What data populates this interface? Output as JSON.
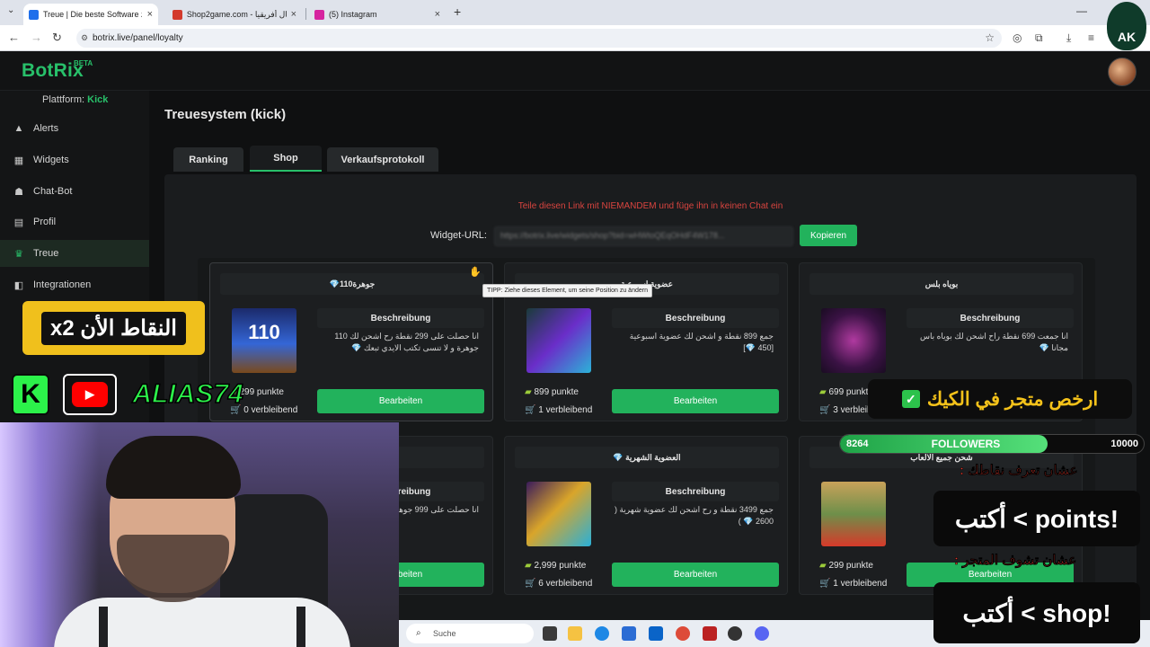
{
  "browser": {
    "tabs": [
      {
        "title": "Treue | Die beste Software zur C",
        "favicon_color": "#1f6feb"
      },
      {
        "title": "Shop2game.com - شمال أفريقيا",
        "favicon_color": "#d33a2c"
      },
      {
        "title": "(5) Instagram",
        "favicon_color": "#d6249f"
      }
    ],
    "url": "botrix.live/panel/loyalty"
  },
  "app": {
    "logo": "BotRix",
    "logo_badge": "BETA",
    "platform_label": "Plattform:",
    "platform_value": "Kick"
  },
  "sidebar": {
    "items": [
      {
        "label": "Alerts",
        "icon": "warning-icon"
      },
      {
        "label": "Widgets",
        "icon": "grid-icon"
      },
      {
        "label": "Chat-Bot",
        "icon": "robot-icon"
      },
      {
        "label": "Profil",
        "icon": "id-card-icon"
      },
      {
        "label": "Treue",
        "icon": "trophy-icon",
        "active": true
      },
      {
        "label": "Integrationen",
        "icon": "plug-icon"
      }
    ]
  },
  "main": {
    "title": "Treuesystem (kick)",
    "tabs": [
      {
        "label": "Ranking"
      },
      {
        "label": "Shop",
        "active": true
      },
      {
        "label": "Verkaufsprotokoll"
      }
    ],
    "warning": "Teile diesen Link mit NIEMANDEM und füge ihn in keinen Chat ein",
    "widget_url_label": "Widget-URL:",
    "widget_url_value": "https://botrix.live/widgets/shop?bid=wHWtoQEqOHdF4W178...",
    "copy_button": "Kopieren",
    "tooltip": "TIPP: Ziehe dieses Element, um seine Position zu ändern",
    "edit_label": "Bearbeiten",
    "desc_label": "Beschreibung"
  },
  "cards": [
    {
      "title": "💎110جوهرة",
      "desc": "انا حصلت على 299 نقطة رح اشحن لك 110 جوهرة و لا تنسى تكتب الايدي تبعك 💎",
      "price": "299 punkte",
      "stock": "0 verbleibend"
    },
    {
      "title": "عضوية اسبوعية",
      "desc": "جمع 899 نقطة و اشحن لك عضوية اسبوعية [450 💎]",
      "price": "899 punkte",
      "stock": "1 verbleibend"
    },
    {
      "title": "بوياه بلس",
      "desc": "انا جمعت 699 نقطة راح اشحن لك بوياه باس مجانا 💎",
      "price": "699 punkte",
      "stock": "3 verbleibend"
    },
    {
      "title": "💎 العضوية الشهرية",
      "desc": "جمع 3499 نقطة و رح اشحن لك عضوية شهرية ( 2600 💎 )",
      "price": "2,999 punkte",
      "stock": "6 verbleibend"
    },
    {
      "title": "شحن جميع الالعاب",
      "price": "299 punkte",
      "stock": "1 verbleibend"
    },
    {
      "title": "",
      "desc": "انا حصلت على 999 جوهرة تبعك 💎",
      "price": "",
      "stock": ""
    }
  ],
  "overlay": {
    "points_badge": "النقاط الأن x2",
    "alias": "ALIAS74",
    "promo": "ارخص متجر في الكيك",
    "followers_label": "FOLLOWERS",
    "followers_current": "8264",
    "followers_goal": "10000",
    "followers_progress": 0.8264,
    "hint1": "عشان تعرف نقاطك :",
    "cmd1": "أكتب < points!",
    "hint2": "عشان تشوف المتجر :",
    "cmd2": "أكتب < shop!",
    "channel_logo": "AK"
  },
  "taskbar": {
    "search_placeholder": "Suche"
  }
}
